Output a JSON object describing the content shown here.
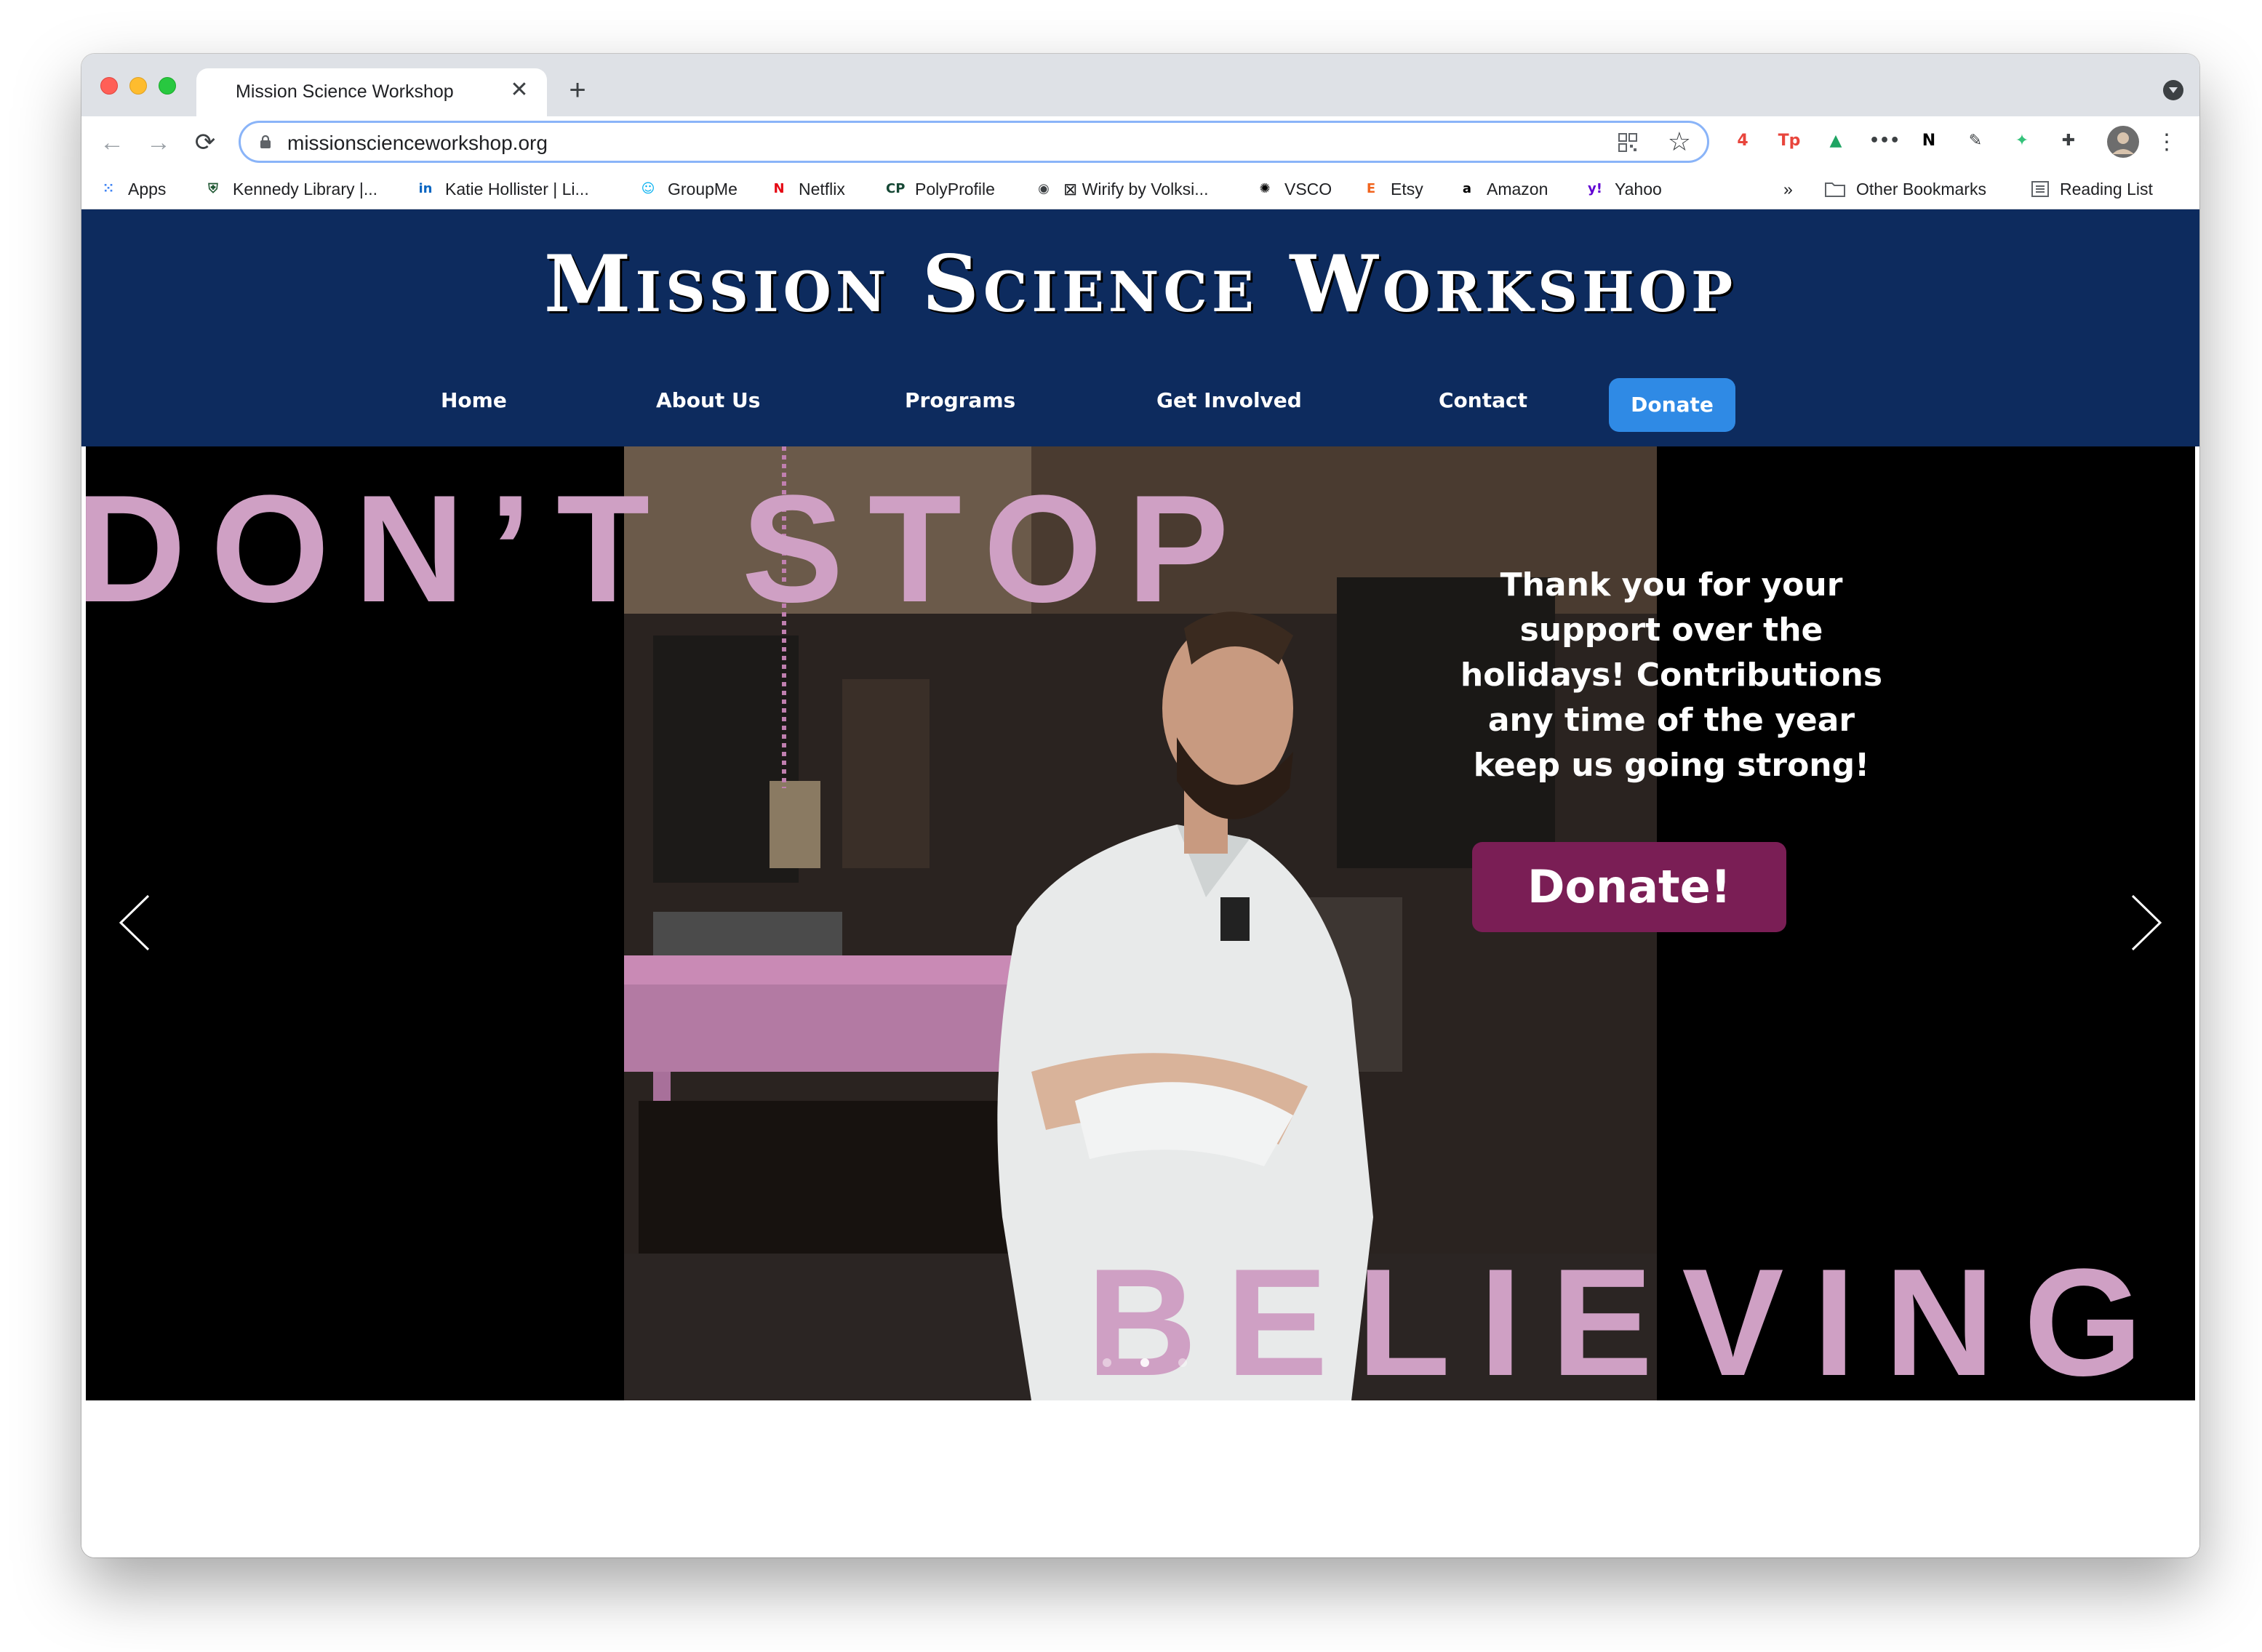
{
  "browser": {
    "tab_title": "Mission Science Workshop",
    "tab_close": "✕",
    "new_tab": "+",
    "url": "missionscienceworkshop.org",
    "nav": {
      "back": "←",
      "forward": "→",
      "reload": "⟳"
    },
    "star": "☆"
  },
  "extensions": [
    {
      "name": "ext-red-badge",
      "label": "4",
      "color": "#e8453c"
    },
    {
      "name": "ext-tp",
      "label": "Tp",
      "color": "#e8453c"
    },
    {
      "name": "ext-drive",
      "label": "▲",
      "color": "#1fa463"
    },
    {
      "name": "ext-dots",
      "label": "•••",
      "color": "#3c4043"
    },
    {
      "name": "ext-notion",
      "label": "N",
      "color": "#000000"
    },
    {
      "name": "ext-eyedropper",
      "label": "✎",
      "color": "#3c4043"
    },
    {
      "name": "ext-bird",
      "label": "✦",
      "color": "#34c27a"
    },
    {
      "name": "ext-puzzle",
      "label": "✚",
      "color": "#3c4043"
    }
  ],
  "bookmarks": {
    "items": [
      {
        "label": "Apps",
        "icon": "grid-icon",
        "glyph": "⁙",
        "color": "#4285f4"
      },
      {
        "label": "Kennedy Library |...",
        "icon": "shield-icon",
        "glyph": "⛨",
        "color": "#1e5631"
      },
      {
        "label": "Katie Hollister | Li...",
        "icon": "linkedin-icon",
        "glyph": "in",
        "color": "#0a66c2"
      },
      {
        "label": "GroupMe",
        "icon": "groupme-icon",
        "glyph": "☺",
        "color": "#00aff0"
      },
      {
        "label": "Netflix",
        "icon": "netflix-icon",
        "glyph": "N",
        "color": "#e50914"
      },
      {
        "label": "PolyProfile",
        "icon": "cp-icon",
        "glyph": "CP",
        "color": "#154734"
      },
      {
        "label": "⊠ Wirify by Volksi...",
        "icon": "globe-icon",
        "glyph": "◉",
        "color": "#3c4043"
      },
      {
        "label": "VSCO",
        "icon": "vsco-icon",
        "glyph": "✺",
        "color": "#000000"
      },
      {
        "label": "Etsy",
        "icon": "etsy-icon",
        "glyph": "E",
        "color": "#f1641e"
      },
      {
        "label": "Amazon",
        "icon": "amazon-icon",
        "glyph": "a",
        "color": "#000000"
      },
      {
        "label": "Yahoo",
        "icon": "yahoo-icon",
        "glyph": "y!",
        "color": "#6001d2"
      }
    ],
    "overflow": "»",
    "other": "Other Bookmarks",
    "reading_list": "Reading List"
  },
  "site": {
    "logo": "Mission Science Workshop",
    "nav": [
      {
        "label": "Home"
      },
      {
        "label": "About Us"
      },
      {
        "label": "Programs"
      },
      {
        "label": "Get Involved"
      },
      {
        "label": "Contact"
      }
    ],
    "donate_label": "Donate"
  },
  "hero": {
    "top_text": "DON’T STOP",
    "bottom_text": "BELIEVING",
    "message": "Thank you for your support over the holidays! Contributions any time of the year keep us going strong!",
    "cta": "Donate!",
    "slides_count": 3,
    "active_slide": 1
  }
}
